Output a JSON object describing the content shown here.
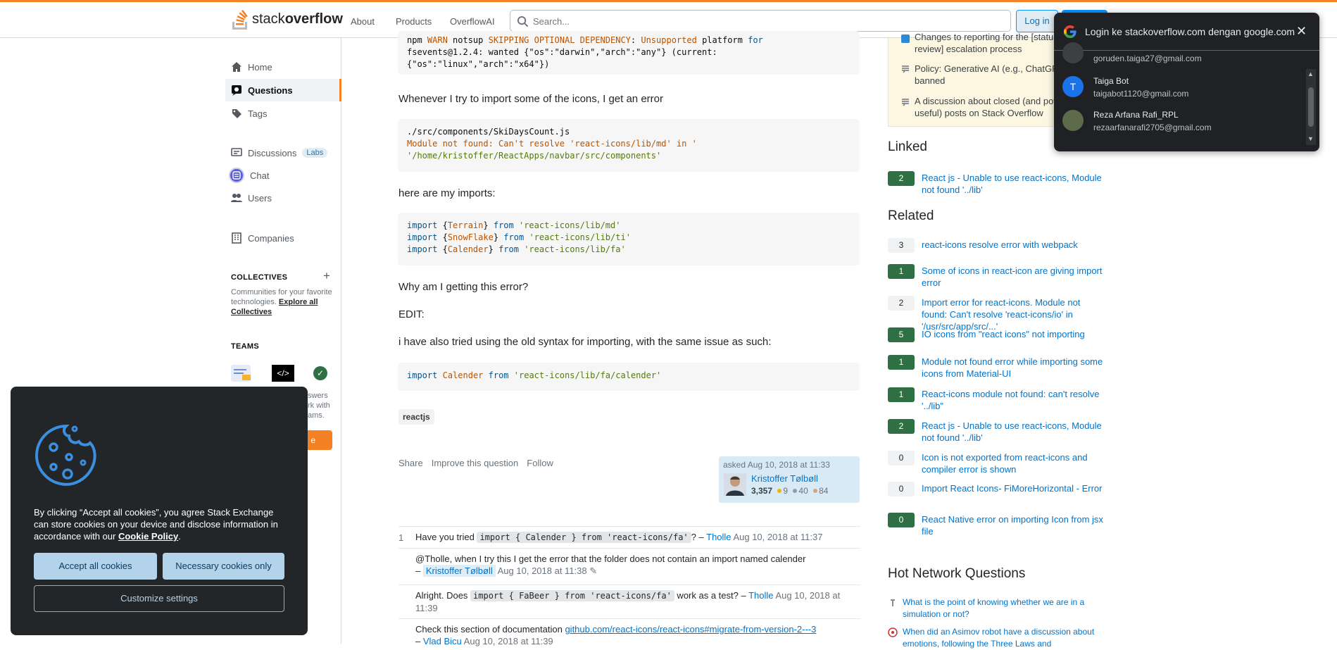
{
  "header": {
    "logo_text_light": "stack",
    "logo_text_bold": "overflow",
    "nav": [
      "About",
      "Products",
      "OverflowAI"
    ],
    "search_placeholder": "Search...",
    "login": "Log in"
  },
  "sidebar": {
    "home": "Home",
    "questions": "Questions",
    "tags": "Tags",
    "discussions": "Discussions",
    "labs": "Labs",
    "chat": "Chat",
    "users": "Users",
    "companies": "Companies",
    "collectives_head": "COLLECTIVES",
    "collectives_desc": "Communities for your favorite technologies.",
    "collectives_link": "Explore all Collectives",
    "teams_head": "TEAMS",
    "teams_partial_1": "swers",
    "teams_partial_2": "rk with",
    "teams_partial_3": "ams.",
    "teams_btn_partial": "e"
  },
  "question": {
    "npm_line1_a": "npm ",
    "npm_line1_b": "WARN",
    "npm_line1_c": " notsup ",
    "npm_line1_d": "SKIPPING OPTIONAL DEPENDENCY",
    "npm_line1_e": ": ",
    "npm_line1_f": "Unsupported",
    "npm_line1_g": " platform ",
    "npm_line1_h": "for",
    "npm_line2": "fsevents@1.2.4: wanted {\"os\":\"darwin\",\"arch\":\"any\"} (current:",
    "npm_line3": "{\"os\":\"linux\",\"arch\":\"x64\"})",
    "p1": "Whenever I try to import some of the icons, I get an error",
    "err_line1": "./src/components/SkiDaysCount.js",
    "err_line2": "Module not found: Can't resolve 'react-icons/lib/md' in '",
    "err_line3": "'/home/kristoffer/ReactApps/navbar/src/components'",
    "p2": "here are my imports:",
    "imports": [
      {
        "name": "Terrain",
        "path": "'react-icons/lib/md'"
      },
      {
        "name": "SnowFlake",
        "path": "'react-icons/lib/ti'"
      },
      {
        "name": "Calender",
        "path": "'react-icons/lib/fa'"
      }
    ],
    "p3": "Why am I getting this error?",
    "p4": "EDIT:",
    "p5": "i have also tried using the old syntax for importing, with the same issue as such:",
    "old_import_name": "Calender",
    "old_import_path": "'react-icons/lib/fa/calender'",
    "tag": "reactjs",
    "actions": [
      "Share",
      "Improve this question",
      "Follow"
    ],
    "asked": "asked Aug 10, 2018 at 11:33",
    "user": "Kristoffer Tølbøll",
    "rep": "3,357",
    "gold": "9",
    "silver": "40",
    "bronze": "84"
  },
  "comments": [
    {
      "score": "1",
      "pre": "Have you tried ",
      "code": "import { Calender } from 'react-icons/fa'",
      "post": "? –",
      "user": "Tholle",
      "date": "Aug 10, 2018 at 11:37"
    },
    {
      "text": "@Tholle, when I try this I get the error that the folder does not contain an import named calender",
      "user": "Kristoffer Tølbøll",
      "date": "Aug 10, 2018 at 11:38"
    },
    {
      "pre": "Alright. Does ",
      "code": "import { FaBeer } from 'react-icons/fa'",
      "post": " work as a test? –",
      "user": "Tholle",
      "date": "Aug 10, 2018 at",
      "date2": "11:39"
    },
    {
      "pre": "Check this section of documentation ",
      "link": "github.com/react-icons/react-icons#migrate-from-version-2---3",
      "user": "Vlad Bicu",
      "date": "Aug 10, 2018 at 11:39"
    }
  ],
  "meta": [
    {
      "line1": "Changes to reporting for the [status-",
      "line2": "review] escalation process"
    },
    {
      "line1": "Policy: Generative AI (e.g., ChatGPT)",
      "line2": "banned"
    },
    {
      "line1": "A discussion about closed (and poten-",
      "line2": "useful) posts on Stack Overflow"
    }
  ],
  "linked_head": "Linked",
  "linked": [
    {
      "score": "2",
      "answered": true,
      "title": "React js - Unable to use react-icons, Module not found '../lib'"
    }
  ],
  "related_head": "Related",
  "related": [
    {
      "score": "3",
      "answered": false,
      "title": "react-icons resolve error with webpack"
    },
    {
      "score": "1",
      "answered": true,
      "title": "Some of icons in react-icon are giving import error"
    },
    {
      "score": "2",
      "answered": false,
      "title": "Import error for react-icons. Module not found: Can't resolve 'react-icons/io' in '/usr/src/app/src/...'"
    },
    {
      "score": "5",
      "answered": true,
      "title": "IO icons from \"react icons\" not importing"
    },
    {
      "score": "1",
      "answered": true,
      "title": "Module not found error while importing some icons from Material-UI"
    },
    {
      "score": "1",
      "answered": true,
      "title": "React-icons module not found: can't resolve '../lib\""
    },
    {
      "score": "2",
      "answered": true,
      "title": "React js - Unable to use react-icons, Module not found '../lib'"
    },
    {
      "score": "0",
      "answered": false,
      "title": "Icon is not exported from react-icons and compiler error is shown"
    },
    {
      "score": "0",
      "answered": false,
      "title": "Import React Icons- FiMoreHorizontal - Error"
    },
    {
      "score": "0",
      "answered": true,
      "title": "React Native error on importing Icon from jsx file"
    }
  ],
  "hnq_head": "Hot Network Questions",
  "hnq": [
    {
      "title": "What is the point of knowing whether we are in a simulation or not?"
    },
    {
      "title": "When did an Asimov robot have a discussion about emotions, following the Three Laws and"
    }
  ],
  "google": {
    "title": "Login ke stackoverflow.com dengan google.com",
    "accounts": [
      {
        "name": "",
        "email": "goruden.taiga27@gmail.com"
      },
      {
        "name": "Taiga Bot",
        "email": "taigabot1120@gmail.com",
        "initial": "T"
      },
      {
        "name": "Reza Arfana Rafi_RPL",
        "email": "rezaarfanarafi2705@gmail.com"
      }
    ]
  },
  "cookie": {
    "text": "By clicking “Accept all cookies”, you agree Stack Exchange can store cookies on your device and disclose information in accordance with our ",
    "link": "Cookie Policy",
    "accept": "Accept all cookies",
    "necessary": "Necessary cookies only",
    "customize": "Customize settings"
  },
  "colors": {
    "accent": "#f48225",
    "link": "#0074cc",
    "answered": "#2f6f44"
  }
}
